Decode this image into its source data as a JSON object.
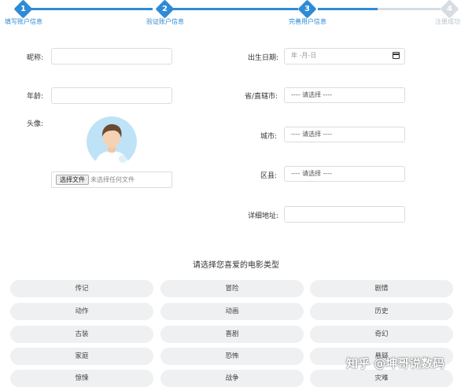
{
  "stepper": {
    "steps": [
      {
        "num": "1",
        "label": "填写账户信息",
        "state": "done"
      },
      {
        "num": "2",
        "label": "验证账户信息",
        "state": "done"
      },
      {
        "num": "3",
        "label": "完善用户信息",
        "state": "active"
      },
      {
        "num": "4",
        "label": "注册成功",
        "state": "pending"
      }
    ],
    "colors": {
      "active": "#2e8bd6",
      "pending": "#d6dde3",
      "pending_text": "#b8c3cc"
    }
  },
  "form": {
    "nickname_label": "昵称:",
    "age_label": "年龄:",
    "avatar_label": "头像:",
    "file_button": "选择文件",
    "file_status": "未选择任何文件",
    "birthday_label": "出生日期:",
    "birthday_placeholder": "年 -月-日",
    "province_label": "省/直辖市:",
    "province_value": "---- 请选择 ----",
    "city_label": "城市:",
    "city_value": "---- 请选择 ----",
    "district_label": "区县:",
    "district_value": "---- 请选择 ----",
    "address_label": "详细地址:"
  },
  "genres": {
    "title": "请选择您喜爱的电影类型",
    "items": [
      "传记",
      "冒险",
      "剧情",
      "动作",
      "动画",
      "历史",
      "古装",
      "喜剧",
      "奇幻",
      "家庭",
      "恐怖",
      "悬疑",
      "惊悚",
      "战争",
      "灾难"
    ]
  },
  "watermark": "知乎 @坤哥说数码"
}
